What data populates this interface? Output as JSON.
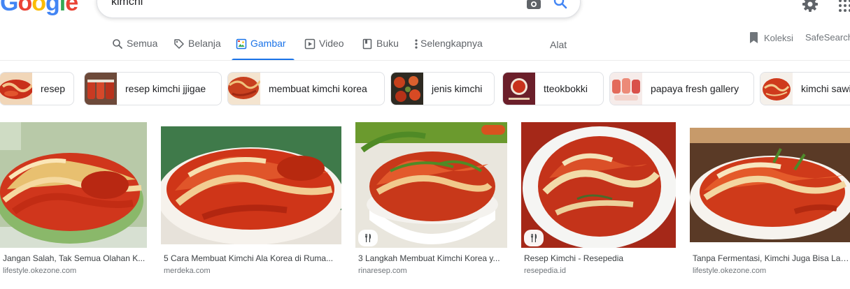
{
  "logo": {
    "letters": [
      "G",
      "o",
      "o",
      "g",
      "l",
      "e"
    ]
  },
  "search": {
    "query": "kimchi"
  },
  "tabs": [
    {
      "label": "Semua",
      "icon": "search-icon"
    },
    {
      "label": "Belanja",
      "icon": "tag-icon"
    },
    {
      "label": "Gambar",
      "icon": "image-icon",
      "active": true
    },
    {
      "label": "Video",
      "icon": "play-icon"
    },
    {
      "label": "Buku",
      "icon": "book-icon"
    },
    {
      "label": "Selengkapnya",
      "icon": "more-vert-icon"
    }
  ],
  "tools_label": "Alat",
  "collections_label": "Koleksi",
  "safesearch_label": "SafeSearch",
  "chips": [
    {
      "label": "resep"
    },
    {
      "label": "resep kimchi jjigae"
    },
    {
      "label": "membuat kimchi korea"
    },
    {
      "label": "jenis kimchi"
    },
    {
      "label": "tteokbokki"
    },
    {
      "label": "papaya fresh gallery"
    },
    {
      "label": "kimchi sawi"
    }
  ],
  "results": [
    {
      "title": "Jangan Salah, Tak Semua Olahan K...",
      "site": "lifestyle.okezone.com"
    },
    {
      "title": "5 Cara Membuat Kimchi Ala Korea di Ruma...",
      "site": "merdeka.com"
    },
    {
      "title": "3 Langkah Membuat Kimchi Korea y...",
      "site": "rinaresep.com"
    },
    {
      "title": "Resep Kimchi - Resepedia",
      "site": "resepedia.id"
    },
    {
      "title": "Tanpa Fermentasi, Kimchi Juga Bisa Lange",
      "site": "lifestyle.okezone.com"
    }
  ],
  "colors": {
    "accent": "#1a73e8",
    "text": "#202124",
    "muted": "#70757a",
    "kimchi_red": "#d2381a"
  }
}
